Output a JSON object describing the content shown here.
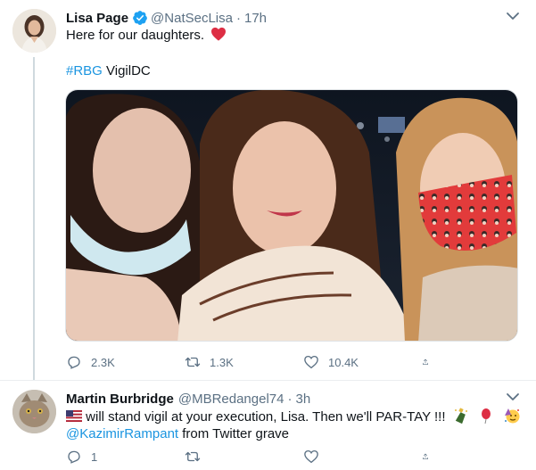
{
  "tweet1": {
    "author_name": "Lisa Page",
    "handle": "@NatSecLisa",
    "separator": "·",
    "time": "17h",
    "text_line1": "Here for our daughters.",
    "hashtag": "#RBG",
    "text_line2_rest": " VigilDC",
    "replies": "2.3K",
    "retweets": "1.3K",
    "likes": "10.4K"
  },
  "tweet2": {
    "author_name": "Martin Burbridge",
    "handle": "@MBRedangel74",
    "separator": "·",
    "time": "3h",
    "text_line1": " will stand vigil at your execution, Lisa. Then we'll PAR-TAY !!!",
    "mention": "@KazimirRampant",
    "text_line2_rest": " from Twitter grave",
    "replies": "1",
    "retweets": "",
    "likes": ""
  },
  "colors": {
    "accent": "#1b95e0",
    "muted": "#5b7083",
    "heart": "#e0245e",
    "verified": "#1da1f2"
  },
  "icons": [
    "verified-badge-icon",
    "chevron-down-icon",
    "reply-icon",
    "retweet-icon",
    "like-icon",
    "share-icon",
    "heart-emoji",
    "us-flag-emoji",
    "champagne-emoji",
    "balloon-emoji",
    "party-face-emoji"
  ]
}
